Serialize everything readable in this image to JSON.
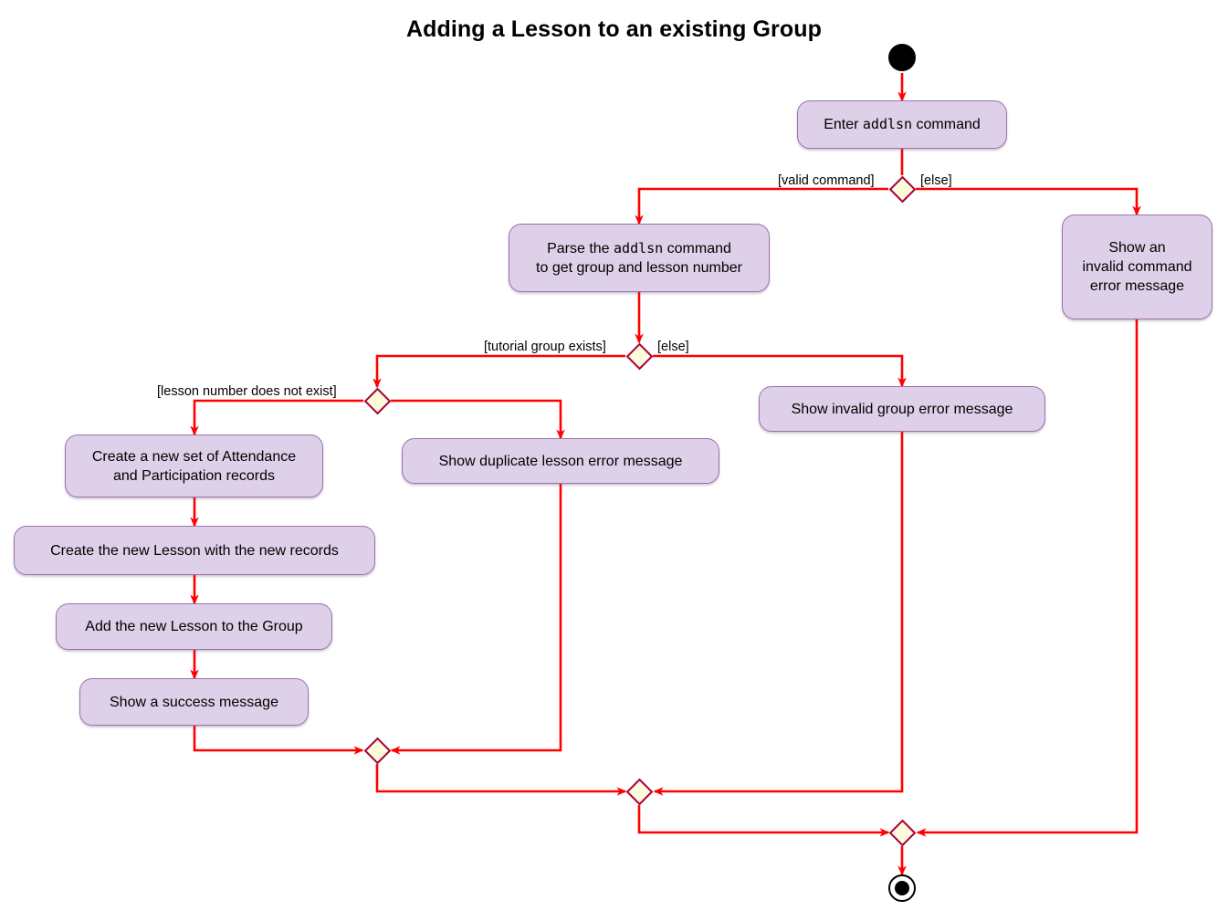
{
  "diagram": {
    "title": "Adding a Lesson to an existing Group",
    "type": "uml-activity-diagram",
    "colors": {
      "activity_fill": "#DDD0E8",
      "activity_border": "#9C72AF",
      "decision_fill": "#FCFBDD",
      "decision_border": "#A80036",
      "edge": "#FF0000",
      "start_end": "#000000",
      "background": "#FFFFFF",
      "text": "#000000"
    },
    "nodes": {
      "start": {
        "name": "start-node"
      },
      "enter_command": {
        "text_before": "Enter ",
        "text_mono": "addlsn",
        "text_after": " command",
        "full_text": "Enter addlsn command"
      },
      "parse_command": {
        "line1_before": "Parse the ",
        "line1_mono": "addlsn",
        "line1_after": " command",
        "line2": "to get group and lesson number",
        "full_text": "Parse the addlsn command to get group and lesson number"
      },
      "invalid_command_error": {
        "full_text": "Show an\ninvalid command\nerror message"
      },
      "invalid_group_error": {
        "full_text": "Show invalid group error message"
      },
      "duplicate_lesson_error": {
        "full_text": "Show duplicate lesson error message"
      },
      "create_records": {
        "full_text": "Create a new set of Attendance\nand Participation records"
      },
      "create_lesson": {
        "full_text": "Create the new Lesson with the new records"
      },
      "add_lesson_to_group": {
        "full_text": "Add the new Lesson to the Group"
      },
      "success_message": {
        "full_text": "Show a success message"
      },
      "end": {
        "name": "end-node"
      }
    },
    "guards": {
      "valid_command": "[valid command]",
      "else_command": "[else]",
      "tutorial_group_exists": "[tutorial group exists]",
      "else_group": "[else]",
      "lesson_number_does_not_exist": "[lesson number does not exist]"
    },
    "decisions": [
      {
        "id": "decision-command-valid",
        "branches": [
          "[valid command]",
          "[else]"
        ]
      },
      {
        "id": "decision-group-exists",
        "branches": [
          "[tutorial group exists]",
          "[else]"
        ]
      },
      {
        "id": "decision-lesson-exists",
        "branches": [
          "[lesson number does not exist]",
          ""
        ]
      }
    ],
    "merges": [
      {
        "id": "merge-lesson-branch"
      },
      {
        "id": "merge-group-branch"
      },
      {
        "id": "merge-command-branch"
      }
    ]
  }
}
